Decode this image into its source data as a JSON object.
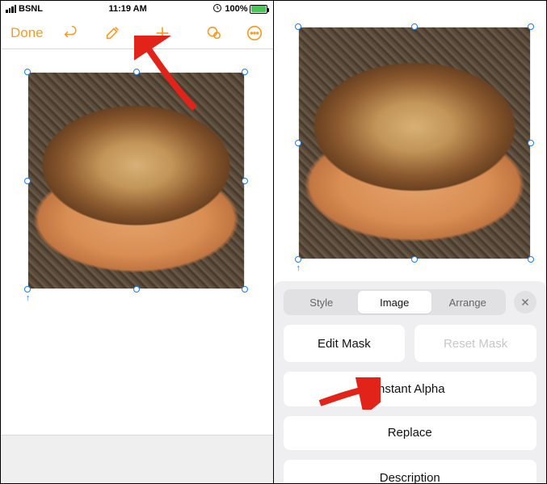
{
  "status": {
    "carrier": "BSNL",
    "time": "11:19 AM",
    "battery_percent": "100%",
    "charging_glyph": "⚡"
  },
  "toolbar": {
    "done": "Done"
  },
  "format_panel": {
    "tabs": {
      "style": "Style",
      "image": "Image",
      "arrange": "Arrange"
    },
    "edit_mask": "Edit Mask",
    "reset_mask": "Reset Mask",
    "instant_alpha": "Instant Alpha",
    "replace": "Replace",
    "description": "Description"
  },
  "icons": {
    "undo": "undo-icon",
    "brush": "brush-icon",
    "add": "add-icon",
    "user": "user-icon",
    "more": "more-icon",
    "lock": "lock-icon"
  }
}
